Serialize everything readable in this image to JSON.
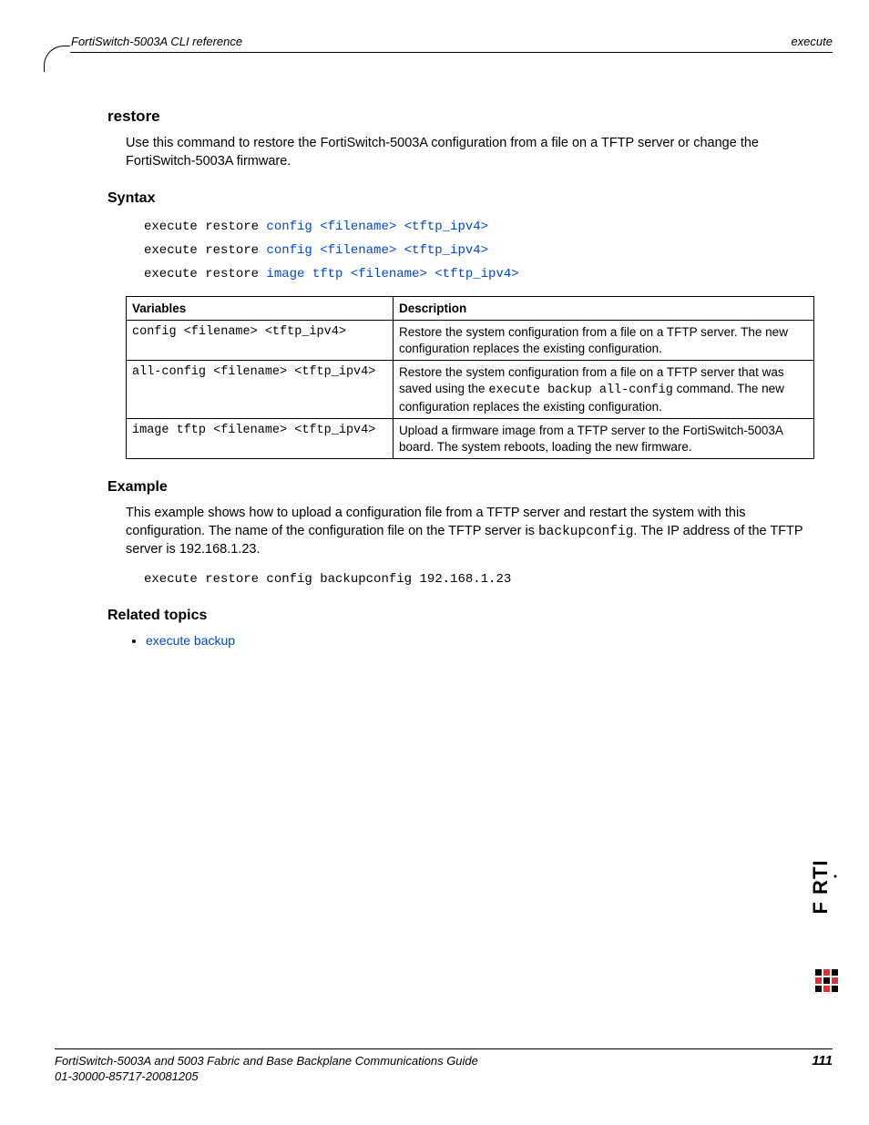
{
  "header": {
    "left": "FortiSwitch-5003A CLI reference",
    "right": "execute"
  },
  "section": {
    "title": "restore",
    "intro": "Use this command to restore the FortiSwitch-5003A configuration from a file on a TFTP server or change the FortiSwitch-5003A firmware."
  },
  "syntax": {
    "heading": "Syntax",
    "lines": [
      {
        "pre": "execute restore ",
        "link": "config <filename> <tftp_ipv4>"
      },
      {
        "pre": "execute restore ",
        "link": "config <filename> <tftp_ipv4>"
      },
      {
        "pre": "execute restore ",
        "link": "image tftp <filename> <tftp_ipv4>"
      }
    ]
  },
  "table": {
    "headers": [
      "Variables",
      "Description"
    ],
    "rows": [
      {
        "var": "config <filename> <tftp_ipv4>",
        "desc_a": "Restore the system configuration from a file on a TFTP server. The new configuration replaces the existing configuration."
      },
      {
        "var": "all-config <filename> <tftp_ipv4>",
        "desc_a": "Restore the system configuration from a file on a TFTP server that was saved using the ",
        "desc_code": "execute backup all-config",
        "desc_b": " command. The new configuration replaces the existing configuration."
      },
      {
        "var": "image tftp <filename> <tftp_ipv4>",
        "desc_a": "Upload a firmware image from a TFTP server to the FortiSwitch-5003A board. The system reboots, loading the new firmware."
      }
    ]
  },
  "example": {
    "heading": "Example",
    "para_a": "This example shows how to upload a configuration file from a TFTP server and restart the system with this configuration. The name of the configuration file on the TFTP server is ",
    "para_code": "backupconfig",
    "para_b": ". The IP address of the TFTP server is 192.168.1.23.",
    "command": "execute restore config backupconfig 192.168.1.23"
  },
  "related": {
    "heading": "Related topics",
    "items": [
      {
        "label": "execute backup"
      }
    ]
  },
  "footer": {
    "line1": "FortiSwitch-5003A and 5003   Fabric and Base Backplane Communications Guide",
    "line2": "01-30000-85717-20081205",
    "page": "111"
  }
}
